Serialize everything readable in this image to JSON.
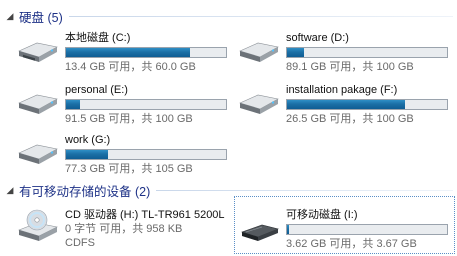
{
  "groups": {
    "hard_disks": {
      "title": "硬盘 (5)",
      "arrow": "◢"
    },
    "removable": {
      "title": "有可移动存储的设备 (2)",
      "arrow": "◢"
    }
  },
  "drives": {
    "c": {
      "name": "本地磁盘 (C:)",
      "space": "13.4 GB 可用，共 60.0 GB",
      "used_fraction": 0.777
    },
    "d": {
      "name": "software (D:)",
      "space": "89.1 GB 可用，共 100 GB",
      "used_fraction": 0.109
    },
    "e": {
      "name": "personal (E:)",
      "space": "91.5 GB 可用，共 100 GB",
      "used_fraction": 0.085
    },
    "f": {
      "name": "installation pakage (F:)",
      "space": "26.5 GB 可用，共 100 GB",
      "used_fraction": 0.735
    },
    "g": {
      "name": "work (G:)",
      "space": "77.3 GB 可用，共 105 GB",
      "used_fraction": 0.264
    },
    "h": {
      "name": "CD 驱动器 (H:) TL-TR961 5200L",
      "space": "0 字节 可用，共 958 KB",
      "fs": "CDFS"
    },
    "i": {
      "name": "可移动磁盘 (I:)",
      "space": "3.62 GB 可用，共 3.67 GB",
      "used_fraction": 0.014
    }
  },
  "colors": {
    "bar_fill": "#1b6fa6",
    "group_title": "#1e3287",
    "selection_border": "#5b8fc7"
  }
}
